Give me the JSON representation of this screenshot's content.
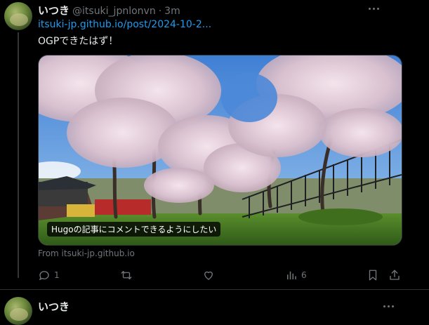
{
  "tweet1": {
    "display_name": "いつき",
    "handle": "@itsuki_jpnlonvn",
    "separator": "·",
    "time": "3m",
    "link_text": "itsuki-jp.github.io/post/2024-10-2...",
    "body_text": "OGPできたはず！",
    "card": {
      "image_caption": "Hugoの記事にコメントできるようにしたい",
      "source": "From itsuki-jp.github.io"
    },
    "actions": {
      "reply_count": "1",
      "retweet_count": "",
      "like_count": "",
      "views_count": "6"
    }
  },
  "tweet2": {
    "display_name": "いつき"
  },
  "colors": {
    "background": "#000000",
    "text_primary": "#e7e9ea",
    "text_secondary": "#71767b",
    "link": "#1d9bf0",
    "border": "#2f3336"
  },
  "icons": [
    "reply-icon",
    "retweet-icon",
    "like-icon",
    "views-icon",
    "bookmark-icon",
    "share-icon",
    "more-icon"
  ]
}
